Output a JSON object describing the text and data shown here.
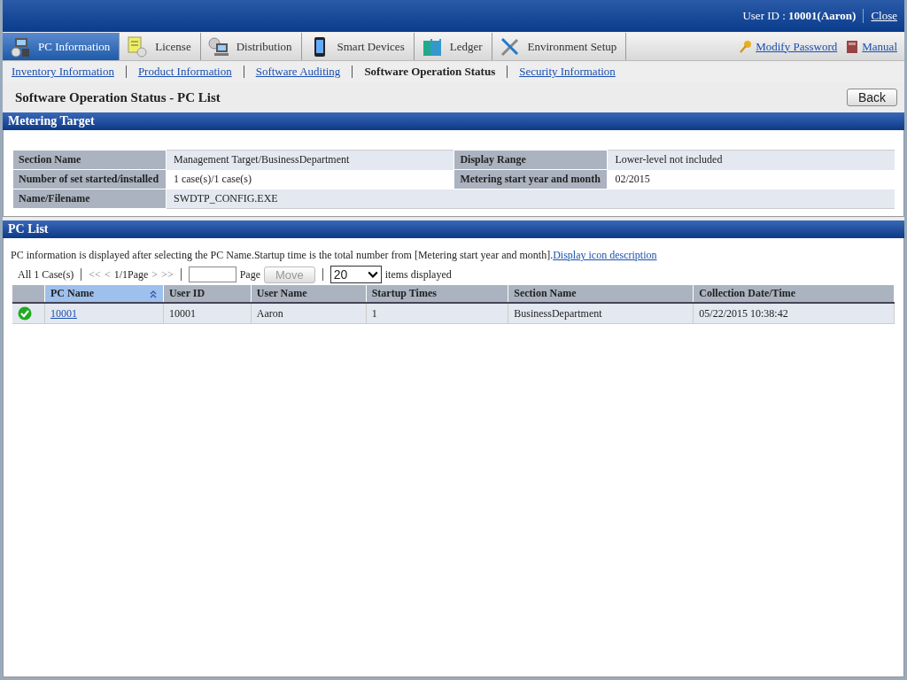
{
  "header": {
    "user": "User ID : **10001(Aaron)**",
    "close": "Close"
  },
  "tabs": [
    {
      "label": "PC Information",
      "selected": true
    },
    {
      "label": "License",
      "selected": false
    },
    {
      "label": "Distribution",
      "selected": false
    },
    {
      "label": "Smart Devices",
      "selected": false
    },
    {
      "label": "Ledger",
      "selected": false
    },
    {
      "label": "Environment Setup",
      "selected": false
    }
  ],
  "top_links": [
    "Modify Password",
    "Manual"
  ],
  "subnav": [
    {
      "label": "Inventory Information",
      "selected": false
    },
    {
      "label": "Product Information",
      "selected": false
    },
    {
      "label": "Software Auditing",
      "selected": false
    },
    {
      "label": "Software Operation Status",
      "selected": true
    },
    {
      "label": "Security Information",
      "selected": false
    }
  ],
  "page_title": "Software Operation Status - PC List",
  "back_button": "Back",
  "metering_target": {
    "title": "Metering Target",
    "rows": [
      [
        {
          "label": "Section Name",
          "value": "Management Target/BusinessDepartment"
        },
        {
          "label": "Display Range",
          "value": "Lower-level not included"
        }
      ],
      [
        {
          "label": "Number of set started/installed",
          "value": "1 case(s)/1 case(s)"
        },
        {
          "label": "Metering start year and month",
          "value": "02/2015"
        }
      ],
      [
        {
          "label": "Name/Filename",
          "value": "SWDTP_CONFIG.EXE"
        }
      ]
    ]
  },
  "pc_list": {
    "title": "PC List",
    "description": "PC information is displayed after selecting the PC Name.Startup time is the total number from [Metering start year and month].",
    "description_link": "Display icon description",
    "pager": {
      "total": "All 1 Case(s)",
      "first": "<<",
      "prev": "<",
      "page": "1/1Page",
      "next": ">",
      "last": ">>",
      "page_label": "Page",
      "move": "Move",
      "move_disabled": true,
      "per_page": "20",
      "per_page_label": "items displayed"
    },
    "columns": [
      {
        "sorted": false
      },
      {
        "label": "PC Name",
        "sorted": true
      },
      {
        "label": "User ID",
        "sorted": false
      },
      {
        "label": "User Name",
        "sorted": false
      },
      {
        "label": "Startup Times",
        "sorted": false
      },
      {
        "label": "Section Name",
        "sorted": false
      },
      {
        "label": "Collection Date/Time",
        "sorted": false
      }
    ],
    "rows": [
      {
        "pc_name": "10001",
        "user_id": "10001",
        "user_name": "Aaron",
        "startup_times": "1",
        "section_name": "BusinessDepartment",
        "collected": "05/22/2015 10:38:42"
      }
    ]
  }
}
